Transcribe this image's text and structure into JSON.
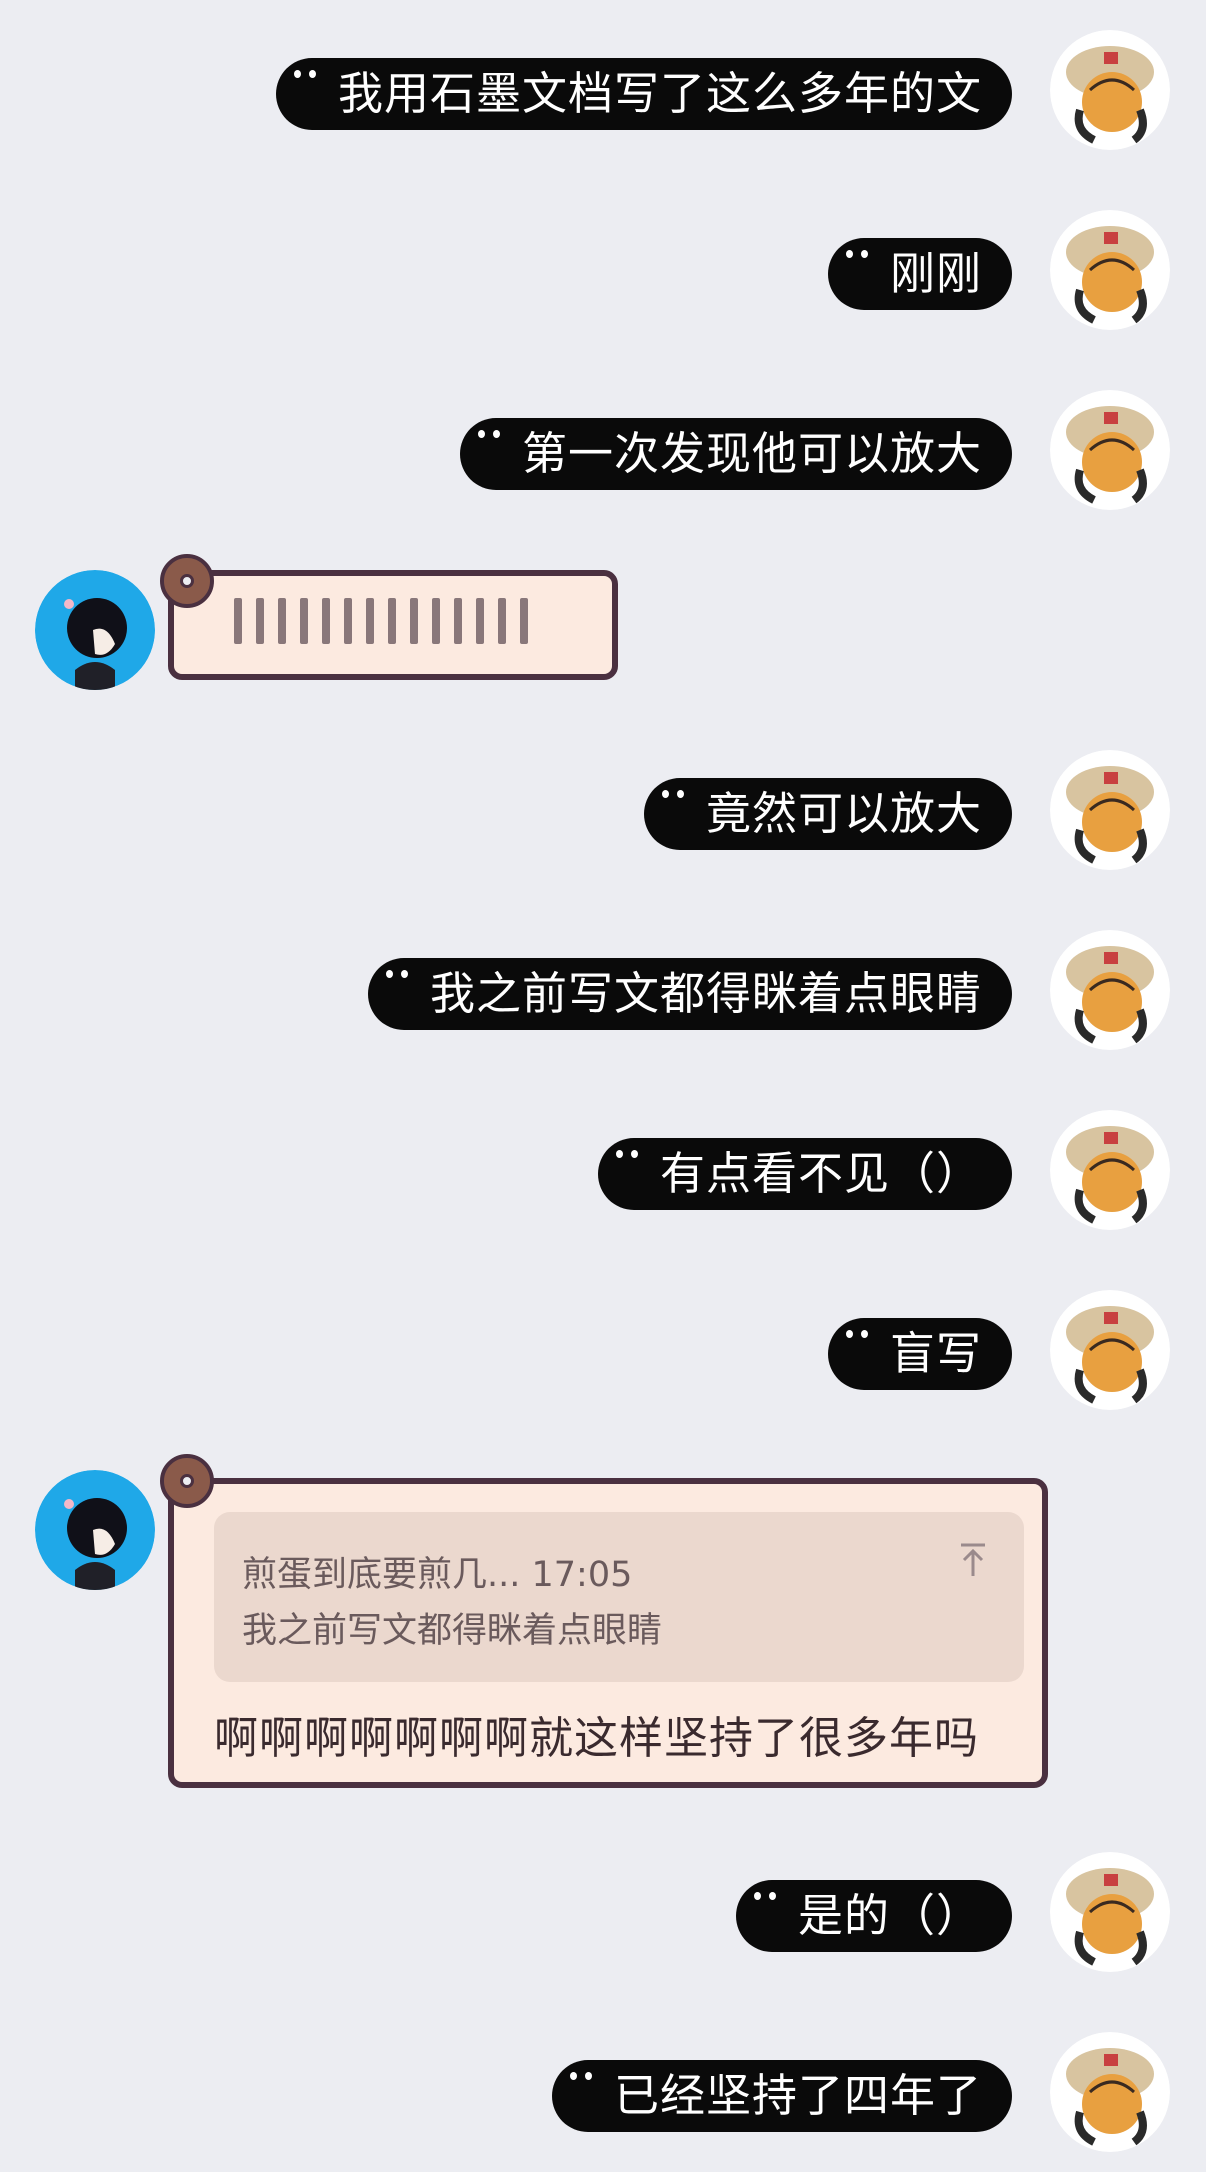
{
  "messages": [
    {
      "id": 1,
      "side": "out",
      "text": "我用石墨文档写了这么多年的文"
    },
    {
      "id": 2,
      "side": "out",
      "text": "刚刚"
    },
    {
      "id": 3,
      "side": "out",
      "text": "第一次发现他可以放大"
    },
    {
      "id": 4,
      "side": "in",
      "type": "voice",
      "text": ""
    },
    {
      "id": 5,
      "side": "out",
      "text": "竟然可以放大"
    },
    {
      "id": 6,
      "side": "out",
      "text": "我之前写文都得眯着点眼睛"
    },
    {
      "id": 7,
      "side": "out",
      "text": "有点看不见（）"
    },
    {
      "id": 8,
      "side": "out",
      "text": "盲写"
    },
    {
      "id": 9,
      "side": "in",
      "type": "reply",
      "quote": {
        "title": "煎蛋到底要煎几... 17:05",
        "body": "我之前写文都得眯着点眼睛"
      },
      "text": "啊啊啊啊啊啊啊就这样坚持了很多年吗"
    },
    {
      "id": 10,
      "side": "out",
      "text": "是的（）"
    },
    {
      "id": 11,
      "side": "out",
      "text": "已经坚持了四年了"
    }
  ],
  "colors": {
    "background": "#ECEDF2",
    "outgoing_bubble": "#0A0A0A",
    "incoming_bubble": "#FCEAE0",
    "incoming_border": "#4A3040",
    "quote_box": "#EBD8CE"
  }
}
